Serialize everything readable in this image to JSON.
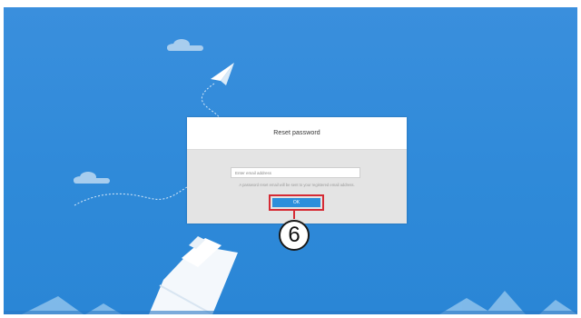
{
  "dialog": {
    "title": "Reset password",
    "email_placeholder": "Enter email address",
    "hint": "A password reset email will be sent to your registered email address.",
    "ok_label": "OK"
  },
  "callout": {
    "number": "6"
  },
  "colors": {
    "background_sky": "#3a8fdd",
    "dialog_body": "#e4e4e4",
    "ok_button": "#2d8fdb",
    "highlight": "#d52b35"
  }
}
